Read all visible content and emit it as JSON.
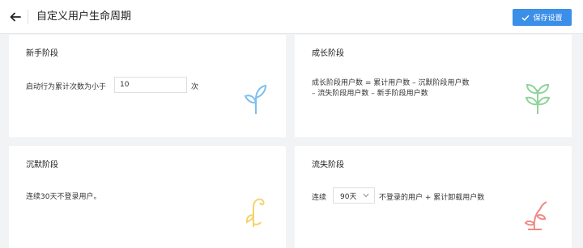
{
  "header": {
    "title": "自定义用户生命周期",
    "save_label": "保存设置"
  },
  "cards": {
    "novice": {
      "title": "新手阶段",
      "prefix": "启动行为累计次数为小于",
      "input_value": "10",
      "suffix": "次",
      "icon": "sprout-icon",
      "icon_color": "#7dbff0"
    },
    "growth": {
      "title": "成长阶段",
      "formula_line1": "成长阶段用户数 = 累计用户数 – 沉默阶段用户数",
      "formula_line2": "– 流失阶段用户数 – 新手阶段用户数",
      "icon": "plant-icon",
      "icon_color": "#8fd49a"
    },
    "silent": {
      "title": "沉默阶段",
      "text": "连续30天不登录用户。",
      "icon": "wilting-plant-icon",
      "icon_color": "#f5d36b"
    },
    "lost": {
      "title": "流失阶段",
      "prefix": "连续",
      "select_value": "90天",
      "suffix": "不登录的用户 + 累计卸载用户数",
      "icon": "dead-plant-icon",
      "icon_color": "#ee8a86"
    }
  },
  "colors": {
    "accent": "#3b8fe8",
    "background": "#f2f3f5"
  }
}
